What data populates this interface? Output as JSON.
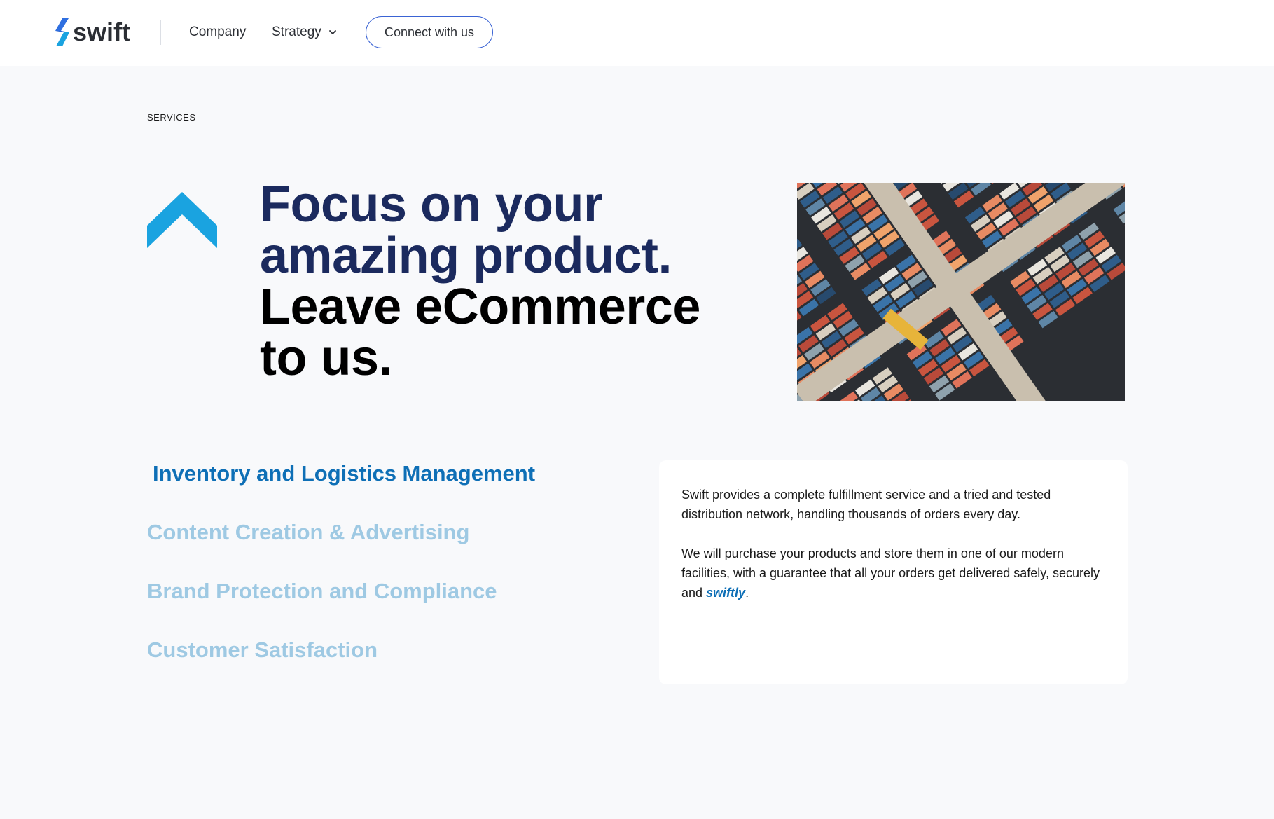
{
  "brand": {
    "name": "swift",
    "accent_color": "#1aa3e0",
    "dark_accent": "#1b2a5e",
    "link_color": "#0e6fb6"
  },
  "nav": {
    "company_label": "Company",
    "strategy_label": "Strategy",
    "connect_label": "Connect with us"
  },
  "section": {
    "eyebrow": "SERVICES"
  },
  "hero": {
    "line1": "Focus on your",
    "line2": "amazing product.",
    "line3": "Leave eCommerce",
    "line4": "to us."
  },
  "services": {
    "items": [
      {
        "label": "Inventory and Logistics Management",
        "active": true
      },
      {
        "label": "Content Creation & Advertising",
        "active": false
      },
      {
        "label": "Brand Protection and Compliance",
        "active": false
      },
      {
        "label": "Customer Satisfaction",
        "active": false
      }
    ]
  },
  "description": {
    "paragraph1": "Swift provides a complete fulfillment service and a tried and tested distribution network, handling thousands of orders every day.",
    "paragraph2_start": "We will purchase your products and store them in one of our modern facilities, with a guarantee that all your orders get delivered safely, securely and ",
    "paragraph2_em": "swiftly",
    "paragraph2_end": "."
  },
  "icons": {
    "logo": "swift-bolt-logo-icon",
    "dropdown": "chevron-down-icon",
    "hero_mark": "chevron-up-icon",
    "hero_image": "shipping-containers-aerial-photo"
  }
}
